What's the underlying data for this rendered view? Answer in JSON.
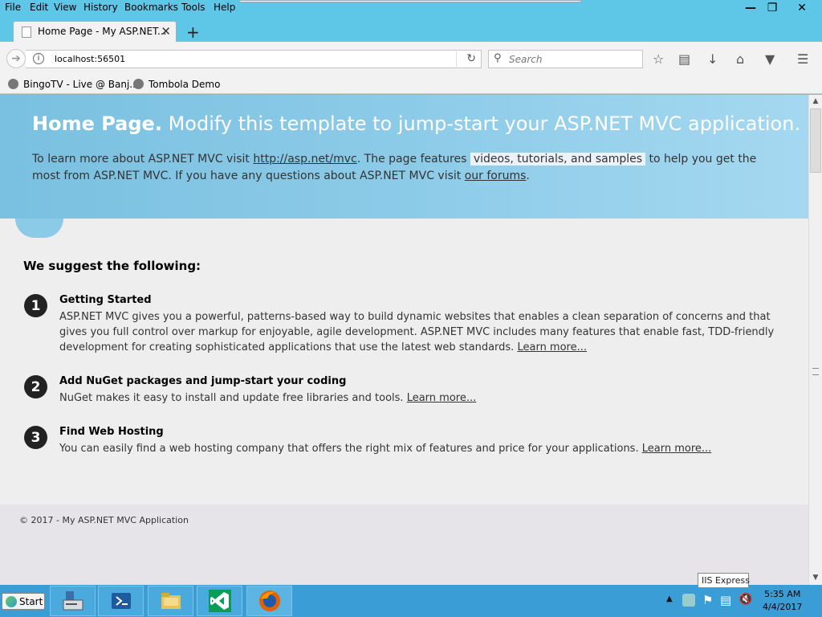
{
  "menu": {
    "items": [
      "File",
      "Edit",
      "View",
      "History",
      "Bookmarks",
      "Tools",
      "Help"
    ]
  },
  "tab": {
    "title": "Home Page - My ASP.NET..."
  },
  "nav": {
    "url": "localhost:56501",
    "search_placeholder": "Search"
  },
  "bookmarks": [
    {
      "label": "BingoTV - Live @ Banj..."
    },
    {
      "label": "Tombola Demo"
    }
  ],
  "hero": {
    "title_bold": "Home Page.",
    "title_rest": "Modify this template to jump-start your ASP.NET MVC application.",
    "text1": "To learn more about ASP.NET MVC visit",
    "link1": "http://asp.net/mvc",
    "text2": ". The page features",
    "highlight": "videos, tutorials, and samples",
    "text3": "to help you get the most from ASP.NET MVC. If you have any questions about ASP.NET MVC visit",
    "link2": "our forums",
    "text4": "."
  },
  "suggest_heading": "We suggest the following:",
  "steps": [
    {
      "num": "1",
      "title": "Getting Started",
      "body": "ASP.NET MVC gives you a powerful, patterns-based way to build dynamic websites that enables a clean separation of concerns and that gives you full control over markup for enjoyable, agile development. ASP.NET MVC includes many features that enable fast, TDD-friendly development for creating sophisticated applications that use the latest web standards.",
      "link": "Learn more..."
    },
    {
      "num": "2",
      "title": "Add NuGet packages and jump-start your coding",
      "body": "NuGet makes it easy to install and update free libraries and tools.",
      "link": "Learn more..."
    },
    {
      "num": "3",
      "title": "Find Web Hosting",
      "body": "You can easily find a web hosting company that offers the right mix of features and price for your applications.",
      "link": "Learn more..."
    }
  ],
  "footer": {
    "text": "© 2017 - My ASP.NET MVC Application"
  },
  "tooltip": "IIS Express",
  "taskbar": {
    "start_label": "Start",
    "time": "5:35 AM",
    "date": "4/4/2017"
  }
}
